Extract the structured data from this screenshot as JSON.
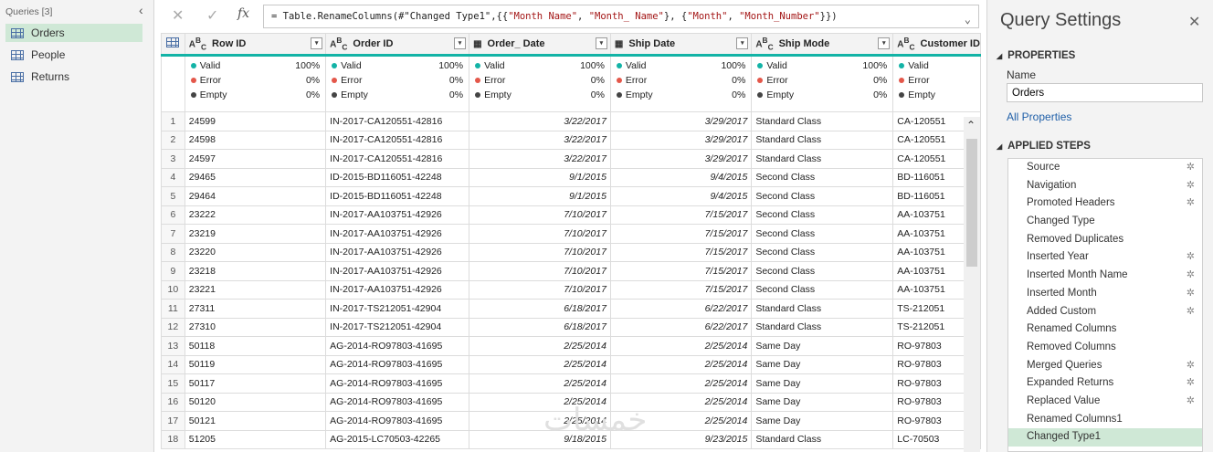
{
  "queries": {
    "header": "Queries [3]",
    "items": [
      {
        "label": "Orders"
      },
      {
        "label": "People"
      },
      {
        "label": "Returns"
      }
    ]
  },
  "formula_bar": {
    "cancel": "✕",
    "confirm": "✓",
    "fx": "fx",
    "formula_prefix": "= Table.RenameColumns(#\"Changed Type1\",{{",
    "formula_s1": "\"Month Name\"",
    "formula_c1": ", ",
    "formula_s2": "\"Month_ Name\"",
    "formula_c2": "}, {",
    "formula_s3": "\"Month\"",
    "formula_c3": ", ",
    "formula_s4": "\"Month_Number\"",
    "formula_suffix": "}})"
  },
  "columns": [
    {
      "type": "ABC",
      "name": "Row ID"
    },
    {
      "type": "ABC",
      "name": "Order ID"
    },
    {
      "type": "date",
      "name": "Order_ Date"
    },
    {
      "type": "date",
      "name": "Ship Date"
    },
    {
      "type": "ABC",
      "name": "Ship Mode"
    },
    {
      "type": "ABC",
      "name": "Customer ID"
    }
  ],
  "quality": {
    "valid_label": "Valid",
    "valid_pct": "100%",
    "error_label": "Error",
    "error_pct": "0%",
    "empty_label": "Empty",
    "empty_pct": "0%"
  },
  "rows": [
    [
      "1",
      "24599",
      "IN-2017-CA120551-42816",
      "3/22/2017",
      "3/29/2017",
      "Standard Class",
      "CA-120551"
    ],
    [
      "2",
      "24598",
      "IN-2017-CA120551-42816",
      "3/22/2017",
      "3/29/2017",
      "Standard Class",
      "CA-120551"
    ],
    [
      "3",
      "24597",
      "IN-2017-CA120551-42816",
      "3/22/2017",
      "3/29/2017",
      "Standard Class",
      "CA-120551"
    ],
    [
      "4",
      "29465",
      "ID-2015-BD116051-42248",
      "9/1/2015",
      "9/4/2015",
      "Second Class",
      "BD-116051"
    ],
    [
      "5",
      "29464",
      "ID-2015-BD116051-42248",
      "9/1/2015",
      "9/4/2015",
      "Second Class",
      "BD-116051"
    ],
    [
      "6",
      "23222",
      "IN-2017-AA103751-42926",
      "7/10/2017",
      "7/15/2017",
      "Second Class",
      "AA-103751"
    ],
    [
      "7",
      "23219",
      "IN-2017-AA103751-42926",
      "7/10/2017",
      "7/15/2017",
      "Second Class",
      "AA-103751"
    ],
    [
      "8",
      "23220",
      "IN-2017-AA103751-42926",
      "7/10/2017",
      "7/15/2017",
      "Second Class",
      "AA-103751"
    ],
    [
      "9",
      "23218",
      "IN-2017-AA103751-42926",
      "7/10/2017",
      "7/15/2017",
      "Second Class",
      "AA-103751"
    ],
    [
      "10",
      "23221",
      "IN-2017-AA103751-42926",
      "7/10/2017",
      "7/15/2017",
      "Second Class",
      "AA-103751"
    ],
    [
      "11",
      "27311",
      "IN-2017-TS212051-42904",
      "6/18/2017",
      "6/22/2017",
      "Standard Class",
      "TS-212051"
    ],
    [
      "12",
      "27310",
      "IN-2017-TS212051-42904",
      "6/18/2017",
      "6/22/2017",
      "Standard Class",
      "TS-212051"
    ],
    [
      "13",
      "50118",
      "AG-2014-RO97803-41695",
      "2/25/2014",
      "2/25/2014",
      "Same Day",
      "RO-97803"
    ],
    [
      "14",
      "50119",
      "AG-2014-RO97803-41695",
      "2/25/2014",
      "2/25/2014",
      "Same Day",
      "RO-97803"
    ],
    [
      "15",
      "50117",
      "AG-2014-RO97803-41695",
      "2/25/2014",
      "2/25/2014",
      "Same Day",
      "RO-97803"
    ],
    [
      "16",
      "50120",
      "AG-2014-RO97803-41695",
      "2/25/2014",
      "2/25/2014",
      "Same Day",
      "RO-97803"
    ],
    [
      "17",
      "50121",
      "AG-2014-RO97803-41695",
      "2/25/2014",
      "2/25/2014",
      "Same Day",
      "RO-97803"
    ],
    [
      "18",
      "51205",
      "AG-2015-LC70503-42265",
      "9/18/2015",
      "9/23/2015",
      "Standard Class",
      "LC-70503"
    ]
  ],
  "settings": {
    "title": "Query Settings",
    "close": "✕",
    "properties_header": "PROPERTIES",
    "name_label": "Name",
    "name_value": "Orders",
    "all_properties": "All Properties",
    "steps_header": "APPLIED STEPS",
    "steps": [
      {
        "label": "Source",
        "gear": true
      },
      {
        "label": "Navigation",
        "gear": true
      },
      {
        "label": "Promoted Headers",
        "gear": true
      },
      {
        "label": "Changed Type",
        "gear": false
      },
      {
        "label": "Removed Duplicates",
        "gear": false
      },
      {
        "label": "Inserted Year",
        "gear": true
      },
      {
        "label": "Inserted Month Name",
        "gear": true
      },
      {
        "label": "Inserted Month",
        "gear": true
      },
      {
        "label": "Added Custom",
        "gear": true
      },
      {
        "label": "Renamed Columns",
        "gear": false
      },
      {
        "label": "Removed Columns",
        "gear": false
      },
      {
        "label": "Merged Queries",
        "gear": true
      },
      {
        "label": "Expanded Returns",
        "gear": true
      },
      {
        "label": "Replaced Value",
        "gear": true
      },
      {
        "label": "Renamed Columns1",
        "gear": false
      },
      {
        "label": "Changed Type1",
        "gear": false
      }
    ]
  },
  "watermark": "خمسات",
  "colors": {
    "accent": "#13b3a6",
    "valid": "#13b3a6",
    "error": "#e4574a",
    "empty": "#444444",
    "selected": "#cfe8d6"
  }
}
